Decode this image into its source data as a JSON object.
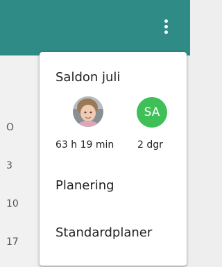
{
  "header": {
    "menu_icon": "more-vertical-icon",
    "color": "#2f8b86"
  },
  "background": {
    "labels": [
      "O",
      "3",
      "10",
      "17"
    ]
  },
  "menu": {
    "title": "Saldon juli",
    "user1": {
      "avatar": "child-photo-avatar",
      "stat": "63 h 19 min"
    },
    "user2": {
      "initials": "SA",
      "color": "#3fbf57",
      "stat": "2 dgr"
    },
    "items": [
      "Planering",
      "Standardplaner"
    ]
  }
}
